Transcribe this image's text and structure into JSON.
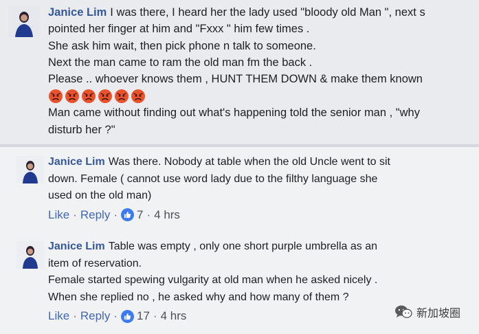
{
  "comments": [
    {
      "author": "Janice Lim",
      "lines": [
        "I was there, I heard her the lady used \"bloody old Man \", next s",
        "pointed her finger at him and \"Fxxx \" him few times .",
        "She ask him wait, then pick phone n talk to someone.",
        "Next the man came to ram the old man fm the back .",
        "Please .. whoever knows them , HUNT THEM DOWN & make them known"
      ],
      "emoji_count": 6,
      "emoji_icon": "angry-face-icon",
      "lines_after": [
        "Man came without finding out what's happening told the senior man , \"why",
        "disturb her ?\""
      ]
    },
    {
      "author": "Janice Lim",
      "lines": [
        "Was there. Nobody at table when the old Uncle went to sit",
        "down. Female ( cannot use word lady due to the filthy language she",
        "used on the old man)"
      ],
      "like_label": "Like",
      "reply_label": "Reply",
      "separator": "·",
      "reaction_count": "7",
      "timestamp": "4 hrs"
    },
    {
      "author": "Janice Lim",
      "lines": [
        "Table was empty , only one short purple umbrella as an",
        "item of reservation.",
        "Female started spewing vulgarity at old man when he asked nicely .",
        "When she replied no , he asked why and how many of them ?"
      ],
      "like_label": "Like",
      "reply_label": "Reply",
      "separator": "·",
      "reaction_count": "17",
      "timestamp": "4 hrs"
    }
  ],
  "watermark": {
    "text": "新加坡圈",
    "icon": "wechat-icon"
  },
  "colors": {
    "name": "#365899",
    "link": "#4267b2",
    "meta": "#606770",
    "like_badge": "#3b7af0",
    "emoji": "#e8532e"
  }
}
